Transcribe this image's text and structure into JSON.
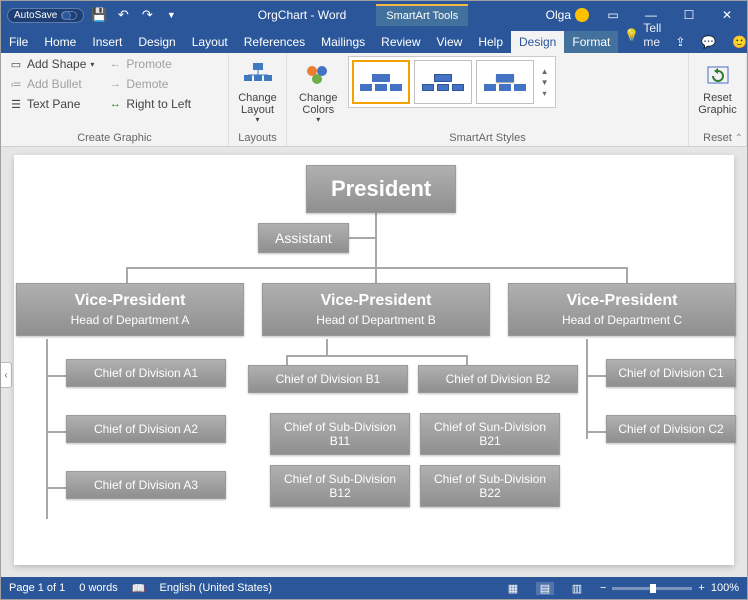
{
  "titlebar": {
    "autosave": "AutoSave",
    "doc_title": "OrgChart - Word",
    "tools_title": "SmartArt Tools",
    "user": "Olga"
  },
  "tabs": {
    "file": "File",
    "home": "Home",
    "insert": "Insert",
    "design": "Design",
    "layout": "Layout",
    "references": "References",
    "mailings": "Mailings",
    "review": "Review",
    "view": "View",
    "help": "Help",
    "sa_design": "Design",
    "sa_format": "Format",
    "tellme": "Tell me"
  },
  "ribbon": {
    "create_graphic": {
      "label": "Create Graphic",
      "add_shape": "Add Shape",
      "add_bullet": "Add Bullet",
      "text_pane": "Text Pane",
      "promote": "Promote",
      "demote": "Demote",
      "right_to_left": "Right to Left"
    },
    "layouts": {
      "label": "Layouts",
      "btn": "Change\nLayout"
    },
    "colors": {
      "btn": "Change\nColors"
    },
    "styles": {
      "label": "SmartArt Styles"
    },
    "reset": {
      "label": "Reset",
      "btn": "Reset\nGraphic"
    }
  },
  "chart_data": {
    "type": "org-chart",
    "nodes": {
      "president": "President",
      "assistant": "Assistant",
      "vp": [
        {
          "title": "Vice-President",
          "sub": "Head of Department A"
        },
        {
          "title": "Vice-President",
          "sub": "Head of Department B"
        },
        {
          "title": "Vice-President",
          "sub": "Head of Department C"
        }
      ],
      "dept_a": [
        "Chief of Division A1",
        "Chief of Division A2",
        "Chief of Division A3"
      ],
      "dept_b_top": [
        "Chief of Division B1",
        "Chief of Division B2"
      ],
      "dept_b_sub": [
        "Chief of Sub-Division B11",
        "Chief of Sun-Division B21",
        "Chief of Sub-Division B12",
        "Chief of Sub-Division B22"
      ],
      "dept_c": [
        "Chief of Division C1",
        "Chief of Division C2"
      ]
    }
  },
  "status": {
    "page": "Page 1 of 1",
    "words": "0 words",
    "lang": "English (United States)",
    "zoom": "100%"
  }
}
